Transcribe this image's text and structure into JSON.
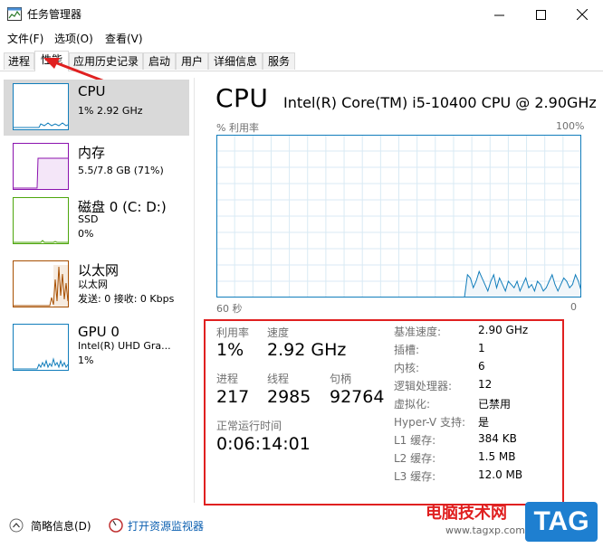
{
  "window": {
    "title": "任务管理器",
    "minimize_icon": "minimize-icon",
    "maximize_icon": "maximize-icon",
    "close_icon": "close-icon"
  },
  "menu": [
    "文件(F)",
    "选项(O)",
    "查看(V)"
  ],
  "tabs": [
    "进程",
    "性能",
    "应用历史记录",
    "启动",
    "用户",
    "详细信息",
    "服务"
  ],
  "active_tab": "性能",
  "sidebar": [
    {
      "name": "CPU",
      "line1": "1% 2.92 GHz",
      "line2": ""
    },
    {
      "name": "内存",
      "line1": "5.5/7.8 GB (71%)",
      "line2": ""
    },
    {
      "name": "磁盘 0 (C: D:)",
      "line1": "SSD",
      "line2": "0%"
    },
    {
      "name": "以太网",
      "line1": "以太网",
      "line2": "发送: 0 接收: 0 Kbps"
    },
    {
      "name": "GPU 0",
      "line1": "Intel(R) UHD Gra...",
      "line2": "1%"
    }
  ],
  "main": {
    "title": "CPU",
    "model": "Intel(R) Core(TM) i5-10400 CPU @ 2.90GHz",
    "util_label": "% 利用率",
    "util_max": "100%",
    "time_left": "60 秒",
    "time_right": "0",
    "usage_series": [
      0,
      0,
      0,
      0,
      0,
      0,
      0,
      0,
      0,
      0,
      0,
      0,
      0,
      0,
      0,
      0,
      0,
      0,
      0,
      0,
      0,
      0,
      0,
      0,
      0,
      0,
      0,
      0,
      0,
      0,
      0,
      0,
      0,
      0,
      0,
      0,
      0,
      0,
      0,
      0,
      0,
      0,
      0,
      0,
      0,
      0,
      0,
      0,
      0,
      0,
      0,
      0,
      0,
      0,
      0,
      0,
      0,
      0,
      0,
      0,
      0,
      0,
      0,
      0,
      0,
      0,
      0,
      0,
      0,
      0,
      0,
      0,
      0,
      0,
      0,
      0,
      0,
      0,
      0,
      0,
      0,
      0,
      0,
      0,
      0,
      0,
      14,
      12,
      6,
      10,
      16,
      12,
      8,
      4,
      10,
      14,
      6,
      12,
      8,
      4,
      10,
      8,
      6,
      10,
      4,
      8,
      12,
      6,
      8,
      4,
      10,
      8,
      4,
      6,
      10,
      14,
      8,
      4,
      8,
      12,
      10,
      6,
      8,
      14,
      10,
      4
    ]
  },
  "stats": {
    "util_label": "利用率",
    "util_value": "1%",
    "speed_label": "速度",
    "speed_value": "2.92 GHz",
    "proc_label": "进程",
    "proc_value": "217",
    "thread_label": "线程",
    "thread_value": "2985",
    "handle_label": "句柄",
    "handle_value": "92764",
    "uptime_label": "正常运行时间",
    "uptime_value": "0:06:14:01"
  },
  "specs": [
    {
      "label": "基准速度:",
      "value": "2.90 GHz"
    },
    {
      "label": "插槽:",
      "value": "1"
    },
    {
      "label": "内核:",
      "value": "6"
    },
    {
      "label": "逻辑处理器:",
      "value": "12"
    },
    {
      "label": "虚拟化:",
      "value": "已禁用"
    },
    {
      "label": "Hyper-V 支持:",
      "value": "是"
    },
    {
      "label": "L1 缓存:",
      "value": "384 KB"
    },
    {
      "label": "L2 缓存:",
      "value": "1.5 MB"
    },
    {
      "label": "L3 缓存:",
      "value": "12.0 MB"
    }
  ],
  "footer": {
    "summary_label": "简略信息(D)",
    "monitor_label": "打开资源监视器"
  },
  "watermark": {
    "site_name": "电脑技术网",
    "url": "www.tagxp.com",
    "badge": "TAG"
  },
  "colors": {
    "cpu_line": "#117dbb",
    "mem_line": "#8b12ae",
    "disk_line": "#4da60c",
    "eth_line": "#a74f01",
    "gpu_line": "#117dbb",
    "highlight_box": "#e02020"
  }
}
